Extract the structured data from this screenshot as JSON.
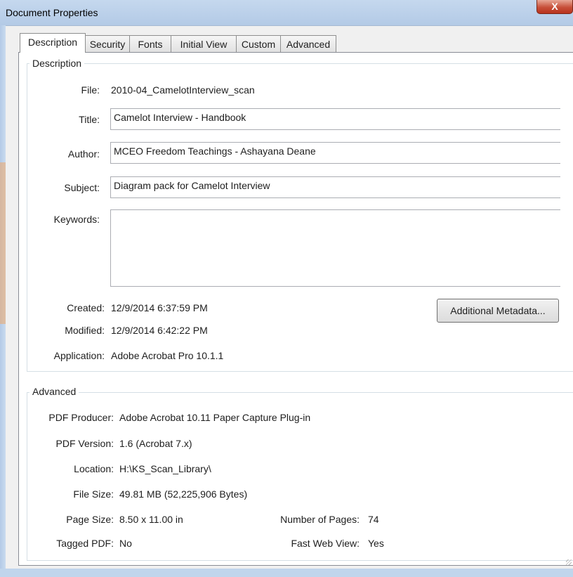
{
  "window": {
    "title": "Document Properties",
    "close_glyph": "X"
  },
  "tabs": [
    {
      "label": "Description"
    },
    {
      "label": "Security"
    },
    {
      "label": "Fonts"
    },
    {
      "label": "Initial View"
    },
    {
      "label": "Custom"
    },
    {
      "label": "Advanced"
    }
  ],
  "description": {
    "legend": "Description",
    "file_label": "File:",
    "file_value": "2010-04_CamelotInterview_scan",
    "title_label": "Title:",
    "title_value": "Camelot Interview - Handbook",
    "author_label": "Author:",
    "author_value": "MCEO Freedom Teachings - Ashayana Deane",
    "subject_label": "Subject:",
    "subject_value": "Diagram pack for Camelot Interview",
    "keywords_label": "Keywords:",
    "keywords_value": "",
    "created_label": "Created:",
    "created_value": "12/9/2014 6:37:59 PM",
    "modified_label": "Modified:",
    "modified_value": "12/9/2014 6:42:22 PM",
    "application_label": "Application:",
    "application_value": "Adobe Acrobat Pro 10.1.1",
    "metadata_button": "Additional Metadata..."
  },
  "advanced": {
    "legend": "Advanced",
    "producer_label": "PDF Producer:",
    "producer_value": "Adobe Acrobat 10.11 Paper Capture Plug-in",
    "version_label": "PDF Version:",
    "version_value": "1.6 (Acrobat 7.x)",
    "location_label": "Location:",
    "location_value": "H:\\KS_Scan_Library\\",
    "filesize_label": "File Size:",
    "filesize_value": "49.81 MB (52,225,906 Bytes)",
    "pagesize_label": "Page Size:",
    "pagesize_value": "8.50 x 11.00 in",
    "pages_label": "Number of Pages:",
    "pages_value": "74",
    "tagged_label": "Tagged PDF:",
    "tagged_value": "No",
    "fastweb_label": "Fast Web View:",
    "fastweb_value": "Yes"
  }
}
